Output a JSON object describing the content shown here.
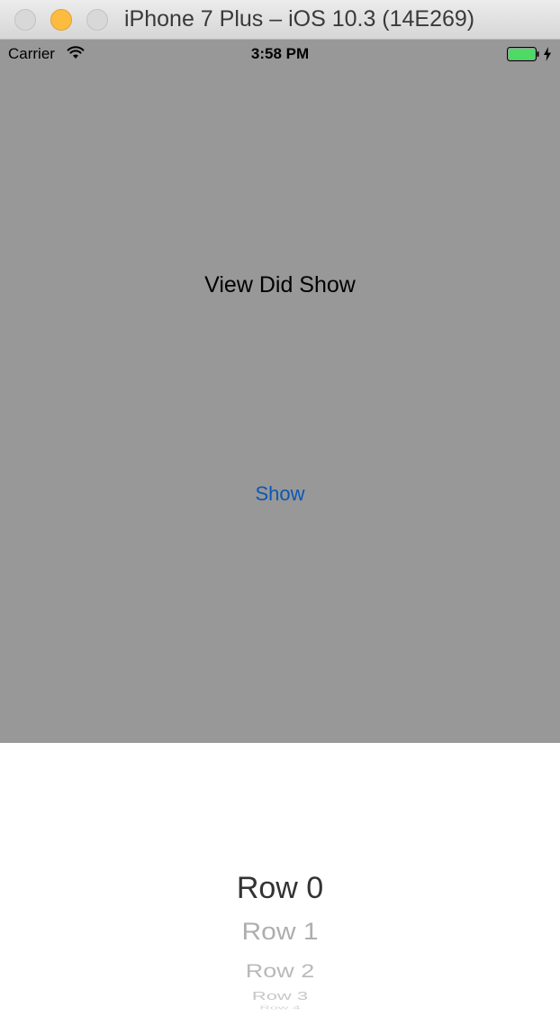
{
  "window": {
    "title": "iPhone 7 Plus – iOS 10.3 (14E269)"
  },
  "status_bar": {
    "carrier": "Carrier",
    "time": "3:58 PM",
    "icons": [
      "wifi-icon",
      "battery-icon",
      "charging-bolt-icon"
    ]
  },
  "main": {
    "label": "View Did Show",
    "show_button": "Show",
    "background_color": "#989898",
    "button_color": "#0c57b4"
  },
  "picker": {
    "rows": [
      "Row 0",
      "Row 1",
      "Row 2",
      "Row 3",
      "Row 4"
    ],
    "selected": "Row 0"
  }
}
